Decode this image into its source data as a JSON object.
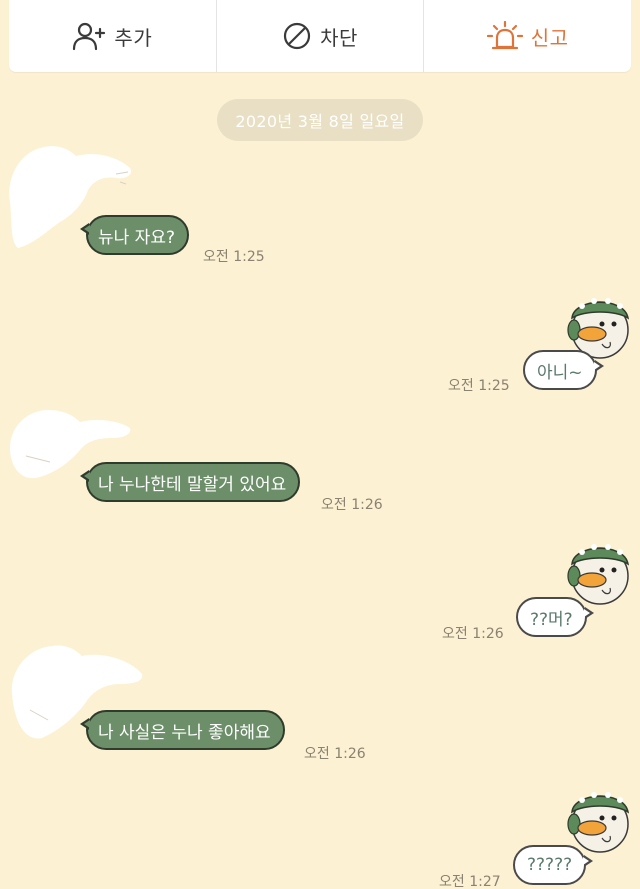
{
  "toolbar": {
    "add_label": "추가",
    "block_label": "차단",
    "report_label": "신고",
    "add_icon": "add-friend-icon",
    "block_icon": "block-icon",
    "report_icon": "siren-icon",
    "report_color": "#e0733a"
  },
  "date_divider": "2020년 3월 8일 일요일",
  "colors": {
    "background": "#fcf1d3",
    "incoming_bubble": "#6c8f6a",
    "outgoing_bubble": "#ffffff"
  },
  "messages": [
    {
      "side": "in",
      "text": "뉴나 자요?",
      "time": "오전 1:25"
    },
    {
      "side": "out",
      "text": "아니~",
      "time": "오전 1:25"
    },
    {
      "side": "in",
      "text": "나 누나한테 말할거 있어요",
      "time": "오전 1:26"
    },
    {
      "side": "out",
      "text": "??머?",
      "time": "오전 1:26"
    },
    {
      "side": "in",
      "text": "나 사실은 누나 좋아해요",
      "time": "오전 1:26"
    },
    {
      "side": "out",
      "text": "?????",
      "time": "오전 1:27"
    }
  ]
}
